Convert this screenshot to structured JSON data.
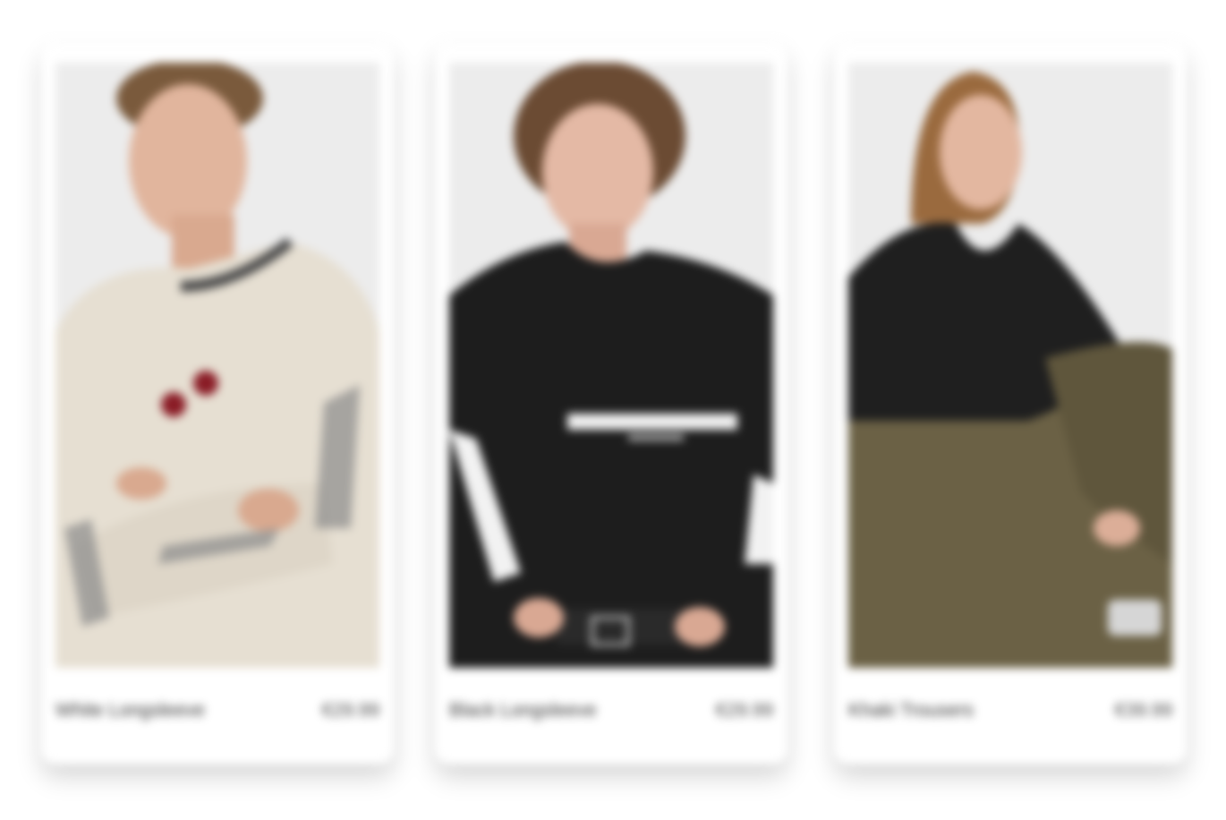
{
  "products": [
    {
      "name": "White Longsleeve",
      "price": "€29.99",
      "image_icon": "man-in-cream-longsleeve-photo",
      "colors": {
        "garment": "#e6dfd2",
        "accent": "#8a1c26",
        "background": "#ececec"
      }
    },
    {
      "name": "Black Longsleeve",
      "price": "€29.99",
      "image_icon": "woman-in-black-longsleeve-photo",
      "colors": {
        "garment": "#1d1d1d",
        "accent": "#f2f2f2",
        "background": "#ececec"
      }
    },
    {
      "name": "Khaki Trousers",
      "price": "€39.99",
      "image_icon": "woman-in-khaki-trousers-photo",
      "colors": {
        "garment": "#1f1f1f",
        "accent": "#6b6145",
        "background": "#ececec"
      }
    }
  ]
}
